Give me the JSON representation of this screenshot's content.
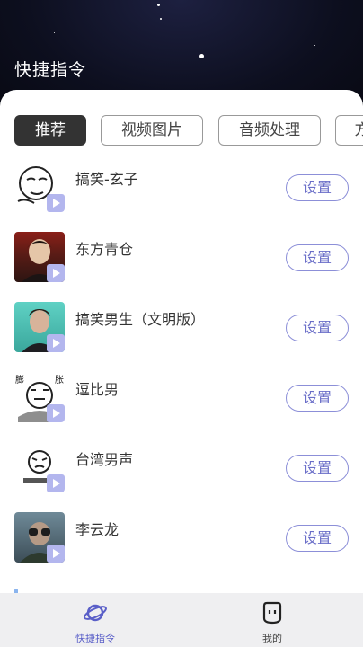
{
  "header": {
    "title": "快捷指令"
  },
  "tabs": [
    {
      "label": "推荐",
      "active": true
    },
    {
      "label": "视频图片",
      "active": false
    },
    {
      "label": "音频处理",
      "active": false
    },
    {
      "label": "方",
      "active": false
    }
  ],
  "items": [
    {
      "title": "搞笑-玄子",
      "button": "设置",
      "thumb_icon": "meme-face"
    },
    {
      "title": "东方青仓",
      "button": "设置",
      "thumb_icon": "portrait-photo"
    },
    {
      "title": "搞笑男生（文明版）",
      "button": "设置",
      "thumb_icon": "portrait-photo"
    },
    {
      "title": "逗比男",
      "button": "设置",
      "thumb_icon": "meme-face",
      "thumb_caption_left": "膨",
      "thumb_caption_right": "胀"
    },
    {
      "title": "台湾男声",
      "button": "设置",
      "thumb_icon": "meme-face"
    },
    {
      "title": "李云龙",
      "button": "设置",
      "thumb_icon": "portrait-photo"
    }
  ],
  "bottom_nav": [
    {
      "label": "快捷指令",
      "icon": "planet-icon",
      "active": true
    },
    {
      "label": "我的",
      "icon": "face-icon",
      "active": false
    }
  ],
  "colors": {
    "accent": "#6a6ec8",
    "tab_active": "#333333",
    "badge": "#b3b6ee"
  }
}
